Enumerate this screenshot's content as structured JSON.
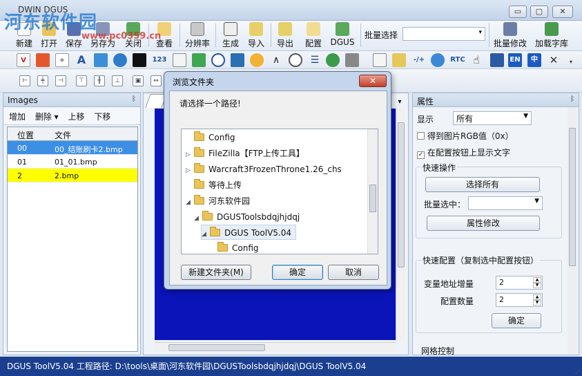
{
  "app": {
    "title": "DWIN DGUS",
    "watermark": "河东软件园",
    "watermark_sub": "www.pc0359.cn"
  },
  "window_buttons": {
    "minimize": "▭",
    "restore": "▢",
    "close": "✕"
  },
  "ribbon": {
    "items": [
      "新建",
      "打开",
      "保存",
      "另存为",
      "关闭",
      "查看",
      "分辨率",
      "生成",
      "导入",
      "导出",
      "配置",
      "DGUS"
    ],
    "batch_select_label": "批量选择",
    "batch_modify": "批量修改",
    "load_font": "加载字库"
  },
  "toolbar2": {
    "text_123": "123",
    "rtc": "RTC",
    "en": "EN",
    "zh": "中",
    "plus_minus": "-/+"
  },
  "images_panel": {
    "title": "Images",
    "toolbar": [
      "增加",
      "删除 ▾",
      "上移",
      "下移"
    ],
    "columns": [
      "位置",
      "文件"
    ],
    "rows": [
      {
        "pos": "00",
        "file": "00_结账刷卡2.bmp"
      },
      {
        "pos": "01",
        "file": "01_01.bmp"
      },
      {
        "pos": "2",
        "file": "2.bmp"
      }
    ]
  },
  "props": {
    "title": "属性",
    "display_label": "显示",
    "display_value": "所有",
    "rgb_label": "得到图片RGB值（0x）",
    "show_text_label": "在配置按钮上显示文字",
    "quick_ops_title": "快速操作",
    "select_all": "选择所有",
    "batch_select_label": "批量选中：",
    "modify_props": "属性修改",
    "quick_config_title": "快速配置（复制选中配置按钮）",
    "var_addr_inc": "变量地址增量",
    "var_addr_value": "2",
    "config_count": "配置数量",
    "config_count_value": "2",
    "confirm": "确定",
    "grid_control": "网格控制"
  },
  "dialog": {
    "title": "浏览文件夹",
    "close": "✕",
    "prompt": "请选择一个路径!",
    "tree": [
      {
        "label": "Config",
        "arrow": ""
      },
      {
        "label": "FileZilla【FTP上传工具】",
        "arrow": "▷"
      },
      {
        "label": "Warcraft3FrozenThrone1.26_chs",
        "arrow": "▷"
      },
      {
        "label": "等待上传",
        "arrow": ""
      },
      {
        "label": "河东软件园",
        "arrow": "◢"
      },
      {
        "label": "DGUSToolsbdqjhjdqj",
        "arrow": "◢"
      },
      {
        "label": "DGUS ToolV5.04",
        "arrow": "◢"
      },
      {
        "label": "Config",
        "arrow": ""
      }
    ],
    "new_folder": "新建文件夹(M)",
    "ok": "确定",
    "cancel": "取消"
  },
  "status": {
    "text": "DGUS ToolV5.04  工程路径: D:\\tools\\桌面\\河东软件园\\DGUSToolsbdqjhjdqj\\DGUS ToolV5.04"
  },
  "colors": {
    "status_bg": "#1b3f8e",
    "canvas_blue": "#0a14b8",
    "row_selected": "#3d8fe6",
    "row_yellow": "#ffff00"
  }
}
